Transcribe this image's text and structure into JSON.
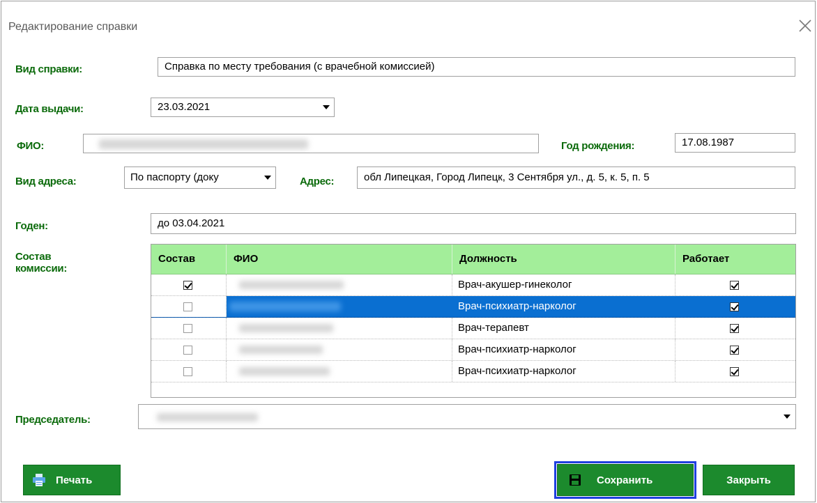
{
  "window": {
    "title": "Редактирование справки"
  },
  "labels": {
    "cert_type": "Вид справки:",
    "issue_date": "Дата выдачи:",
    "fio": "ФИО:",
    "birth_year": "Год рождения:",
    "address_type": "Вид адреса:",
    "address": "Адрес:",
    "valid": "Годен:",
    "commission": "Состав\nкомиссии:",
    "chairman": "Председатель:"
  },
  "fields": {
    "cert_type": "Справка по месту требования (с врачебной комиссией)",
    "issue_date": "23.03.2021",
    "birth_date": "17.08.1987",
    "address_type": "По паспорту (доку",
    "address": "обл Липецкая, Город Липецк, 3 Сентября ул., д. 5, к. 5, п. 5",
    "valid": "до 03.04.2021"
  },
  "grid": {
    "columns": [
      "Состав",
      "ФИО",
      "Должность",
      "Работает"
    ],
    "rows": [
      {
        "included": true,
        "position": "Врач-акушер-гинеколог",
        "works": true,
        "selected": false
      },
      {
        "included": false,
        "position": "Врач-психиатр-нарколог",
        "works": true,
        "selected": true
      },
      {
        "included": false,
        "position": "Врач-терапевт",
        "works": true,
        "selected": false
      },
      {
        "included": false,
        "position": "Врач-психиатр-нарколог",
        "works": true,
        "selected": false
      },
      {
        "included": false,
        "position": "Врач-психиатр-нарколог",
        "works": true,
        "selected": false
      }
    ]
  },
  "buttons": {
    "print": "Печать",
    "save": "Сохранить",
    "close": "Закрыть"
  },
  "colors": {
    "label_green": "#0a6a0a",
    "header_green": "#a3ee9a",
    "button_green": "#1c8a2d",
    "selection_blue": "#0a6fd1",
    "focus_blue": "#1f3fe0"
  }
}
